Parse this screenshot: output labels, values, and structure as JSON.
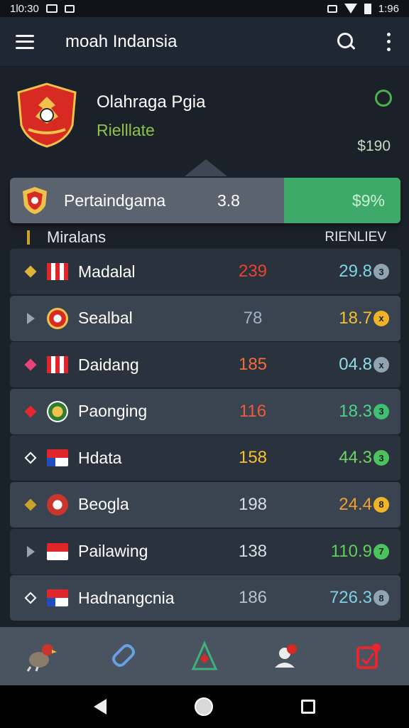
{
  "status_bar": {
    "time_left": "1l0:30",
    "time_right": "1:96"
  },
  "app_bar": {
    "title": "moah Indansia"
  },
  "profile": {
    "name": "Olahraga Pgia",
    "subtitle": "Rielllate",
    "amount": "$190"
  },
  "summary": {
    "label": "Pertaindgama",
    "value": "3.8",
    "highlight": "$9%"
  },
  "table": {
    "left_header": "Miralans",
    "right_header": "RIENLIEV"
  },
  "rows": [
    {
      "name": "Madalal",
      "score": "239",
      "score_color": "#e8432f",
      "stat": "29.8",
      "stat_color": "#7fd3e6",
      "coin": "3",
      "coin_color": "#8fa3b0",
      "marker": "diamond",
      "marker_color": "#e0b23a",
      "badge": "flag-stripes"
    },
    {
      "name": "Sealbal",
      "score": "78",
      "score_color": "#9fb3c8",
      "stat": "18.7",
      "stat_color": "#f3c12d",
      "coin": "x",
      "coin_color": "#f0b429",
      "marker": "arrow",
      "marker_color": "#9aa3ad",
      "badge": "crest"
    },
    {
      "name": "Daidang",
      "score": "185",
      "score_color": "#f26b3a",
      "stat": "04.8",
      "stat_color": "#8fdde6",
      "coin": "x",
      "coin_color": "#8fa3b0",
      "marker": "diamond",
      "marker_color": "#e8437a",
      "badge": "flag-stripes"
    },
    {
      "name": "Paonging",
      "score": "116",
      "score_color": "#f05a3c",
      "stat": "18.3",
      "stat_color": "#4cd48a",
      "coin": "3",
      "coin_color": "#3fbf72",
      "marker": "diamond",
      "marker_color": "#e8262f",
      "badge": "crest-green"
    },
    {
      "name": "Hdata",
      "score": "158",
      "score_color": "#f6c12b",
      "stat": "44.3",
      "stat_color": "#6fd36a",
      "coin": "3",
      "coin_color": "#4cc25c",
      "marker": "diamond-outline",
      "marker_color": "#ffffff",
      "badge": "flag-blue"
    },
    {
      "name": "Beogla",
      "score": "198",
      "score_color": "#d8dde2",
      "stat": "24.4",
      "stat_color": "#f0a02f",
      "coin": "8",
      "coin_color": "#f0b429",
      "marker": "diamond",
      "marker_color": "#c9a227",
      "badge": "crest-red"
    },
    {
      "name": "Pailawing",
      "score": "138",
      "score_color": "#d8dde2",
      "stat": "110.9",
      "stat_color": "#5fd05a",
      "coin": "7",
      "coin_color": "#4cc25c",
      "marker": "arrow",
      "marker_color": "#9aa3ad",
      "badge": "flag-red"
    },
    {
      "name": "Hadnangcnia",
      "score": "186",
      "score_color": "#b9c2cb",
      "stat": "726.3",
      "stat_color": "#7fcfe6",
      "coin": "8",
      "coin_color": "#8fa3b0",
      "marker": "diamond-outline",
      "marker_color": "#ffffff",
      "badge": "flag-blue"
    }
  ],
  "colors": {
    "accent_green": "#3fa96a",
    "background": "#1b2129",
    "app_bar": "#1e2732"
  }
}
